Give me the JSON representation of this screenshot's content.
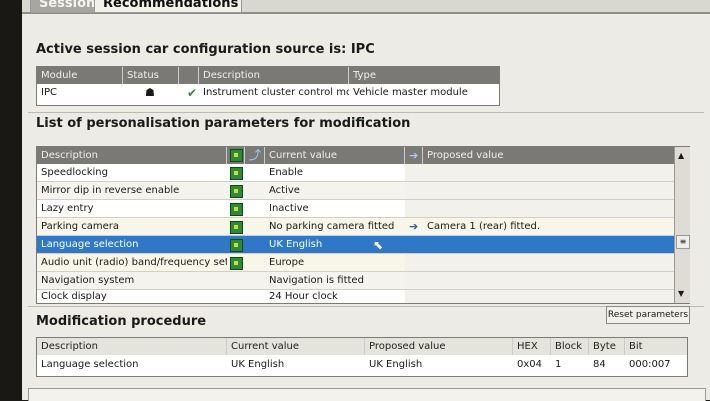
{
  "tabs": [
    {
      "label": "Session"
    },
    {
      "label": "Recommendations"
    }
  ],
  "car_config": {
    "title": "Active session car configuration source is: IPC",
    "headers": [
      "Module",
      "Status",
      "",
      "Description",
      "Type"
    ],
    "row": {
      "module": "IPC",
      "description": "Instrument cluster control mod...",
      "type": "Vehicle master module"
    }
  },
  "params": {
    "title": "List of personalisation parameters for modification",
    "headers": {
      "description": "Description",
      "current": "Current value",
      "proposed": "Proposed value"
    },
    "rows": [
      {
        "description": "Speedlocking",
        "current": "Enable",
        "proposed": ""
      },
      {
        "description": "Mirror dip in reverse enable",
        "current": "Active",
        "proposed": ""
      },
      {
        "description": "Lazy entry",
        "current": "Inactive",
        "proposed": ""
      },
      {
        "description": "Parking camera",
        "current": "No parking camera fitted",
        "proposed": "Camera 1 (rear) fitted."
      },
      {
        "description": "Language selection",
        "current": "UK English",
        "proposed": ""
      },
      {
        "description": "Audio unit (radio) band/frequency setting",
        "current": "Europe",
        "proposed": ""
      },
      {
        "description": "Navigation system",
        "current": "Navigation is fitted",
        "proposed": ""
      },
      {
        "description": "Clock display",
        "current": "24 Hour clock",
        "proposed": ""
      }
    ]
  },
  "modification": {
    "title": "Modification procedure",
    "reset_label": "Reset parameters",
    "headers": [
      "Description",
      "Current value",
      "Proposed value",
      "HEX",
      "Block",
      "Byte",
      "Bit"
    ],
    "row": {
      "description": "Language selection",
      "current": "UK English",
      "proposed": "UK English",
      "hex": "0x04",
      "block": "1",
      "byte": "84",
      "bit": "000:007"
    }
  },
  "colors": {
    "selected_row": "#2f78c8",
    "header": "#7a7975"
  }
}
